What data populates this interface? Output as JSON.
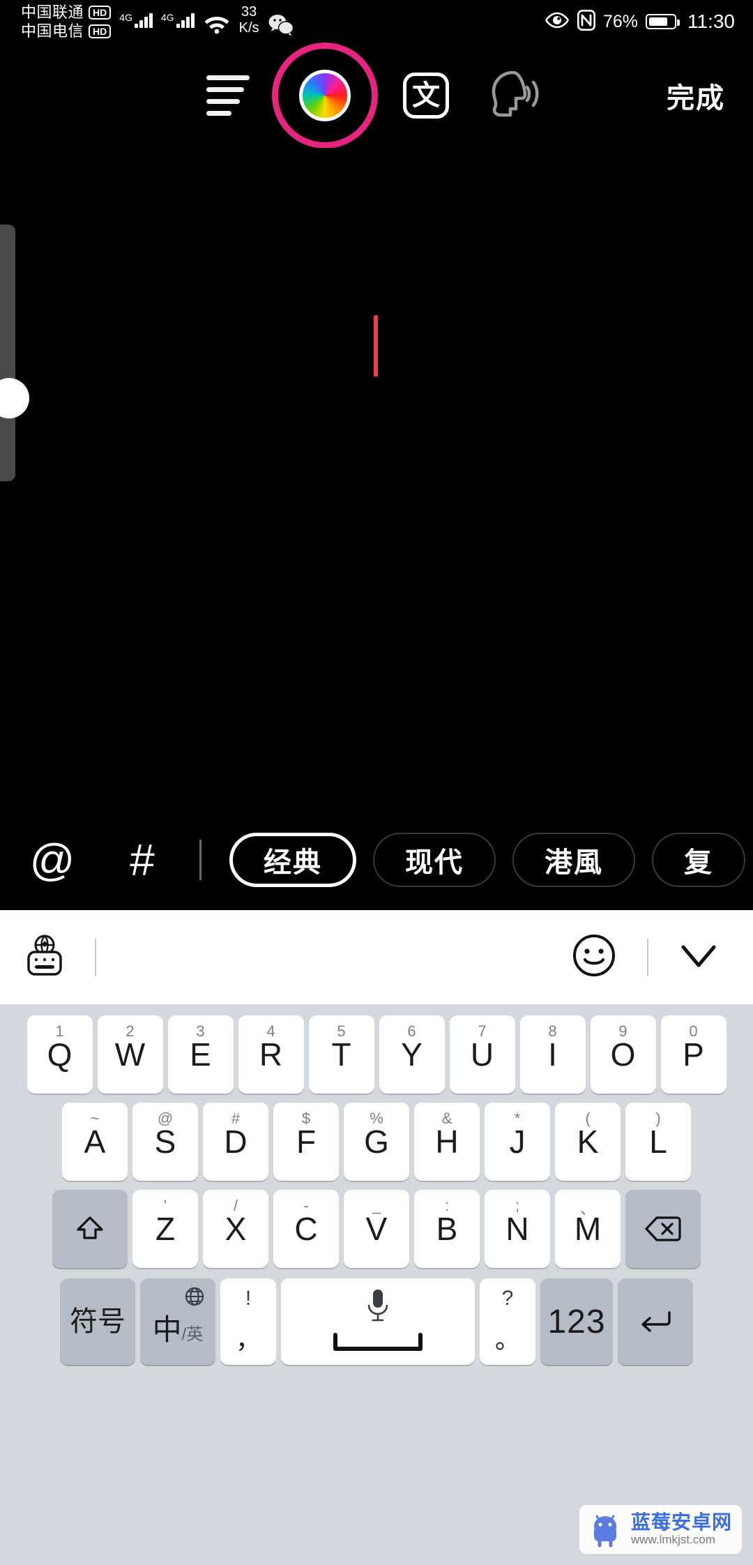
{
  "statusbar": {
    "carrier1": "中国联通",
    "carrier1_badge": "HD",
    "carrier2": "中国电信",
    "carrier2_badge": "HD",
    "net_type_1": "4G",
    "net_type_2": "4G",
    "net_speed_value": "33",
    "net_speed_unit": "K/s",
    "battery_percent": "76%",
    "battery_level": 76,
    "clock": "11:30",
    "icons": [
      "wifi-icon",
      "wechat-icon",
      "eye-comfort-icon",
      "nfc-icon",
      "battery-icon"
    ]
  },
  "toolbar": {
    "align_icon": "text-align-icon",
    "color_picker_label": "color-wheel",
    "color_ring": "#e6257e",
    "text_style_label": "文",
    "speech_icon": "speech-head-icon",
    "done_label": "完成"
  },
  "canvas": {
    "caret_color": "#ef3f4a",
    "text_value": ""
  },
  "chiprow": {
    "mention_label": "@",
    "hashtag_label": "#",
    "styles": [
      {
        "label": "经典",
        "selected": true
      },
      {
        "label": "现代",
        "selected": false
      },
      {
        "label": "港風",
        "selected": false
      },
      {
        "label": "复",
        "selected": false
      }
    ]
  },
  "kb_toolbar": {
    "globe_icon": "globe-keyboard-icon",
    "emoji_icon": "emoji-smiley-icon",
    "collapse_icon": "chevron-down-icon"
  },
  "keyboard": {
    "row1": [
      {
        "sup": "1",
        "main": "Q"
      },
      {
        "sup": "2",
        "main": "W"
      },
      {
        "sup": "3",
        "main": "E"
      },
      {
        "sup": "4",
        "main": "R"
      },
      {
        "sup": "5",
        "main": "T"
      },
      {
        "sup": "6",
        "main": "Y"
      },
      {
        "sup": "7",
        "main": "U"
      },
      {
        "sup": "8",
        "main": "I"
      },
      {
        "sup": "9",
        "main": "O"
      },
      {
        "sup": "0",
        "main": "P"
      }
    ],
    "row2": [
      {
        "sup": "~",
        "main": "A"
      },
      {
        "sup": "@",
        "main": "S"
      },
      {
        "sup": "#",
        "main": "D"
      },
      {
        "sup": "$",
        "main": "F"
      },
      {
        "sup": "%",
        "main": "G"
      },
      {
        "sup": "&",
        "main": "H"
      },
      {
        "sup": "*",
        "main": "J"
      },
      {
        "sup": "(",
        "main": "K"
      },
      {
        "sup": ")",
        "main": "L"
      }
    ],
    "row3": [
      {
        "sup": "'",
        "main": "Z"
      },
      {
        "sup": "/",
        "main": "X"
      },
      {
        "sup": "-",
        "main": "C"
      },
      {
        "sup": "_",
        "main": "V"
      },
      {
        "sup": ":",
        "main": "B"
      },
      {
        "sup": ";",
        "main": "N"
      },
      {
        "sup": "、",
        "main": "M"
      }
    ],
    "shift_icon": "shift-up-icon",
    "delete_icon": "backspace-icon",
    "symbols_label": "符号",
    "lang_main": "中",
    "lang_sub": "/英",
    "lang_globe_icon": "globe-icon",
    "comma_sup": "!",
    "comma_main": "，",
    "space_icon": "microphone-icon",
    "space_bar_icon": "spacebar-icon",
    "period_sup": "?",
    "period_main": "。",
    "num_label": "123",
    "enter_icon": "enter-return-icon"
  },
  "watermark": {
    "title": "蓝莓安卓网",
    "url": "www.lmkjst.com",
    "icon": "android-robot-icon"
  }
}
